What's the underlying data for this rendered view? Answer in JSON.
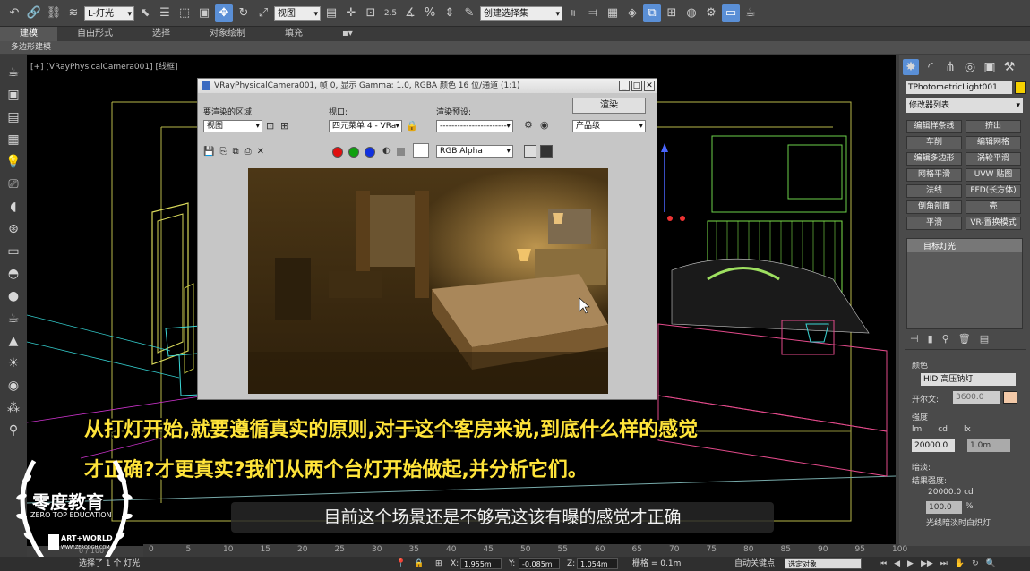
{
  "toolbar": {
    "selection_filter": "L-灯光",
    "ref_coord": "视图",
    "snap_value": "2.5",
    "named_selection": "创建选择集"
  },
  "ribbon": {
    "tabs": [
      "建模",
      "自由形式",
      "选择",
      "对象绘制",
      "填充"
    ],
    "sub_label": "多边形建模"
  },
  "viewport": {
    "label": "[+] [VRayPhysicalCamera001] [线框]"
  },
  "render_window": {
    "title": "VRayPhysicalCamera001, 帧 0, 显示 Gamma: 1.0, RGBA 颜色 16 位/通道 (1:1)",
    "area_label": "要渲染的区域:",
    "area_value": "视图",
    "viewport_label": "视口:",
    "viewport_value": "四元菜单 4 - VRa",
    "preset_label": "渲染预设:",
    "preset_value": "------------------------",
    "render_button": "渲染",
    "quality_value": "产品级",
    "channel_value": "RGB Alpha"
  },
  "right_panel": {
    "object_name": "TPhotometricLight001",
    "modifier_list": "修改器列表",
    "buttons": [
      "编辑样条线",
      "挤出",
      "车削",
      "编辑网格",
      "编辑多边形",
      "涡轮平滑",
      "网格平滑",
      "UVW 贴图",
      "法线",
      "FFD(长方体)",
      "倒角剖面",
      "壳",
      "平滑",
      "VR-置换模式"
    ],
    "stack_item": "目标灯光",
    "color_section": "颜色",
    "lamp_type": "HID 高压钠灯",
    "kelvin_label": "开尔文:",
    "kelvin_value": "3600.0",
    "intensity_section": "强度",
    "unit_lm": "lm",
    "unit_cd": "cd",
    "unit_lx": "lx",
    "intensity_value": "20000.0",
    "distance_value": "1.0m",
    "dimming_section": "暗淡:",
    "result_label": "结果强度:",
    "result_value": "20000.0 cd",
    "percent_value": "100.0",
    "percent_unit": "%",
    "lamp_off_label": "光线暗淡时白炽灯"
  },
  "subtitles": {
    "yellow_line1": "从打灯开始,就要遵循真实的原则,对于这个客房来说,到底什么样的感觉",
    "yellow_line2": "才正确?才更真实?我们从两个台灯开始做起,并分析它们。",
    "white": "目前这个场景还是不够亮这该有曝的感觉才正确"
  },
  "timeline": {
    "ticks": [
      "0",
      "5",
      "10",
      "15",
      "20",
      "25",
      "30",
      "35",
      "40",
      "45",
      "50",
      "55",
      "60",
      "65",
      "70",
      "75",
      "80",
      "85",
      "90",
      "95",
      "100"
    ],
    "frame_counter": "0 / 100"
  },
  "statusbar": {
    "selected": "选择了 1 个 灯光",
    "x_label": "X:",
    "x_value": "1.955m",
    "y_label": "Y:",
    "y_value": "-0.085m",
    "z_label": "Z:",
    "z_value": "1.054m",
    "grid": "栅格 = 0.1m",
    "auto_key": "自动关键点",
    "set_key_value": "选定对象"
  },
  "logo": {
    "brand_cn": "零度教育",
    "brand_en": "ZERO TOP EDUCATION",
    "partner": "ART+WORLD",
    "partner_url": "WWW.ZERODGH.COM"
  },
  "colors": {
    "subtitle_yellow": "#ffe43a",
    "active_blue": "#5a8fd6",
    "kelvin_swatch": "#f3c9a8",
    "lamp_swatch": "#f5d000"
  }
}
